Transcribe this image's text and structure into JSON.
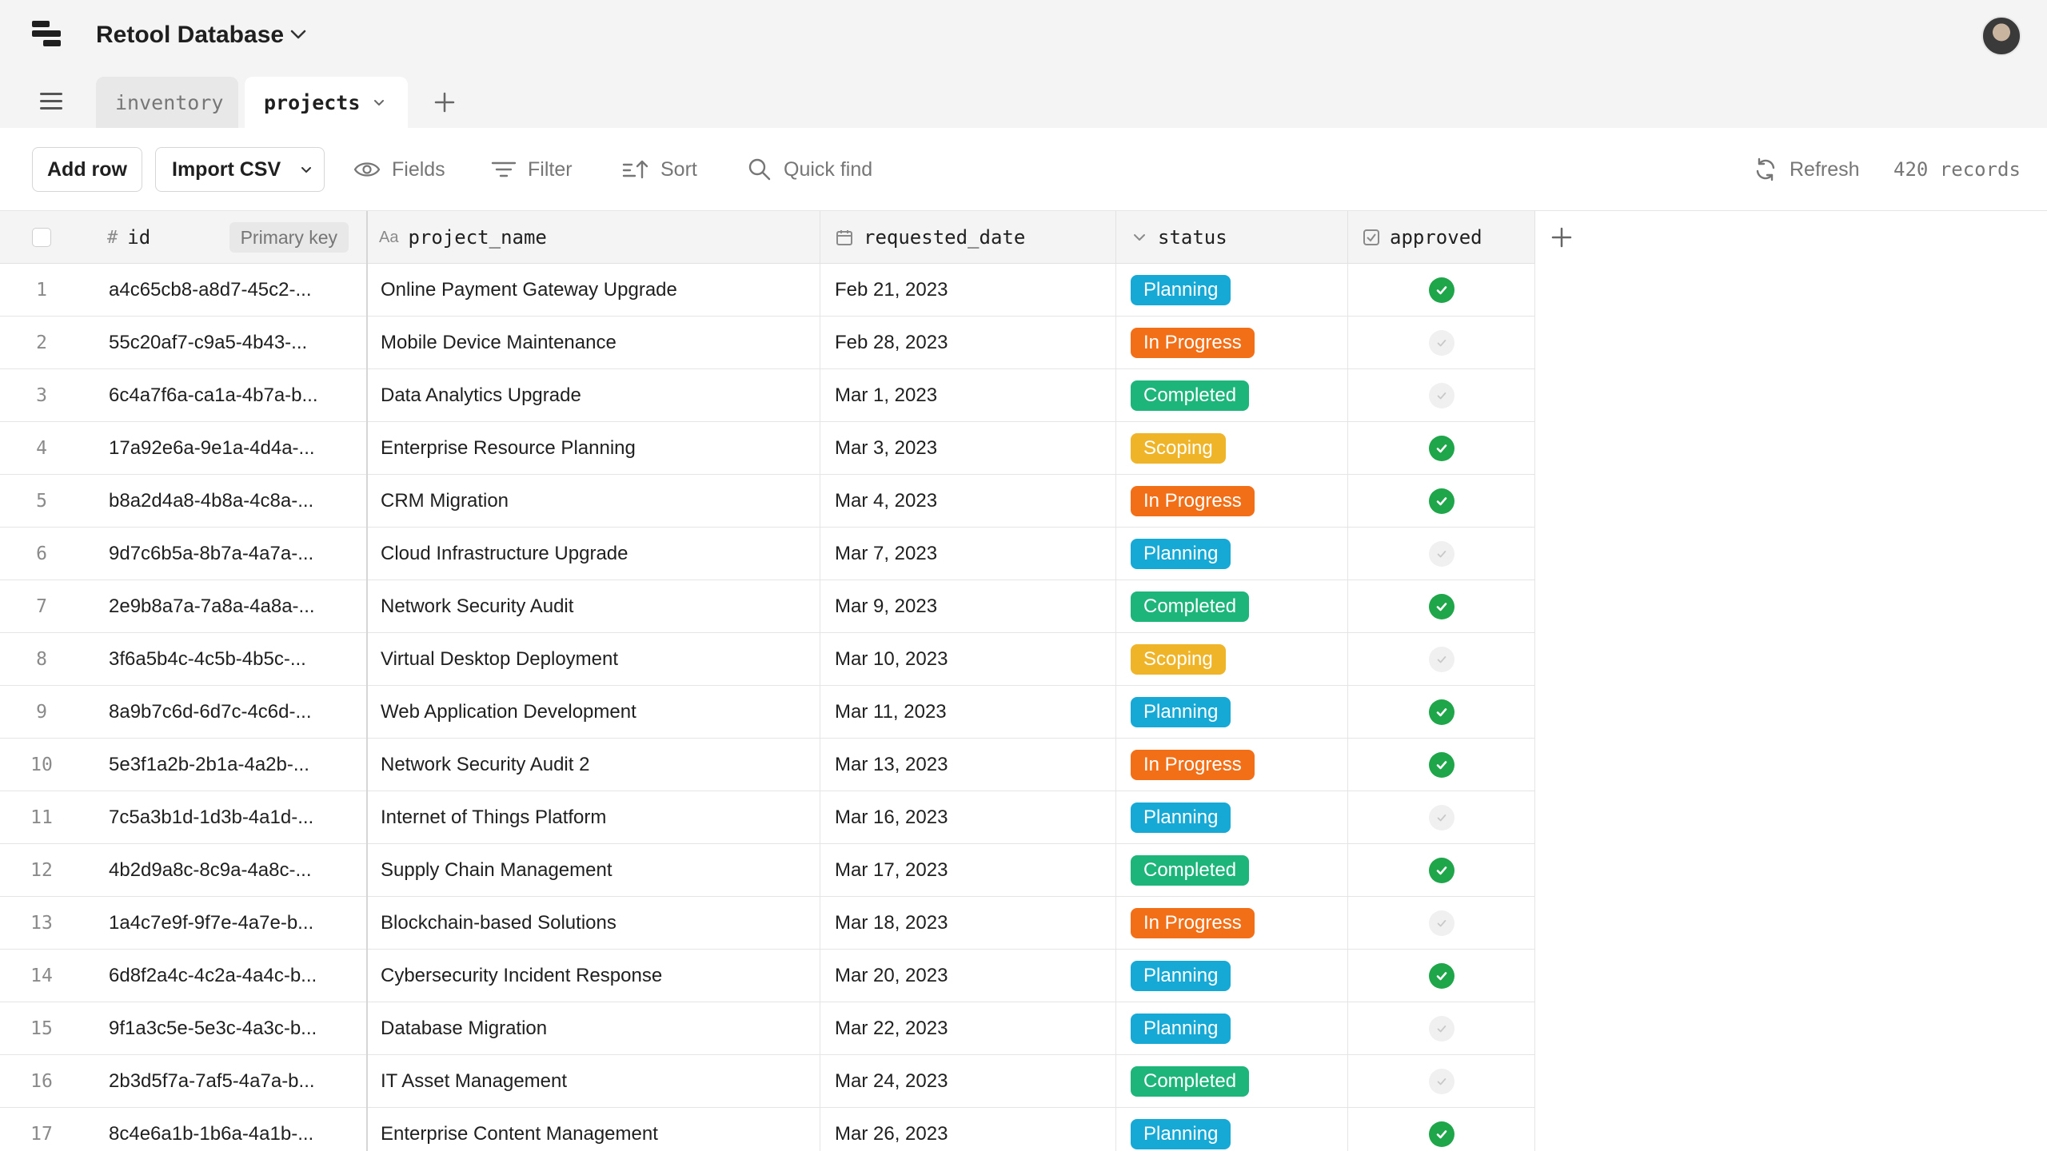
{
  "app": {
    "title": "Retool Database"
  },
  "tabs": [
    {
      "label": "inventory"
    },
    {
      "label": "projects"
    }
  ],
  "toolbar": {
    "add_row": "Add row",
    "import_csv": "Import CSV",
    "fields": "Fields",
    "filter": "Filter",
    "sort": "Sort",
    "quick_find": "Quick find",
    "refresh": "Refresh",
    "records": "420 records"
  },
  "columns": {
    "id": "id",
    "id_tag": "Primary key",
    "project_name": "project_name",
    "requested_date": "requested_date",
    "status": "status",
    "approved": "approved"
  },
  "colors": {
    "Planning": "#17a9d6",
    "In Progress": "#f36f17",
    "Completed": "#1db57a",
    "Scoping": "#f0b429",
    "approved_on": "#1fa54a"
  },
  "rows": [
    {
      "n": "1",
      "id": "a4c65cb8-a8d7-45c2-...",
      "name": "Online Payment Gateway Upgrade",
      "date": "Feb 21, 2023",
      "status": "Planning",
      "approved": true
    },
    {
      "n": "2",
      "id": "55c20af7-c9a5-4b43-...",
      "name": "Mobile Device Maintenance",
      "date": "Feb 28, 2023",
      "status": "In Progress",
      "approved": false
    },
    {
      "n": "3",
      "id": "6c4a7f6a-ca1a-4b7a-b...",
      "name": "Data Analytics Upgrade",
      "date": "Mar 1, 2023",
      "status": "Completed",
      "approved": false
    },
    {
      "n": "4",
      "id": "17a92e6a-9e1a-4d4a-...",
      "name": "Enterprise Resource Planning",
      "date": "Mar 3, 2023",
      "status": "Scoping",
      "approved": true
    },
    {
      "n": "5",
      "id": "b8a2d4a8-4b8a-4c8a-...",
      "name": "CRM Migration",
      "date": "Mar 4, 2023",
      "status": "In Progress",
      "approved": true
    },
    {
      "n": "6",
      "id": "9d7c6b5a-8b7a-4a7a-...",
      "name": "Cloud Infrastructure Upgrade",
      "date": "Mar 7, 2023",
      "status": "Planning",
      "approved": false
    },
    {
      "n": "7",
      "id": "2e9b8a7a-7a8a-4a8a-...",
      "name": "Network Security Audit",
      "date": "Mar 9, 2023",
      "status": "Completed",
      "approved": true
    },
    {
      "n": "8",
      "id": "3f6a5b4c-4c5b-4b5c-...",
      "name": "Virtual Desktop Deployment",
      "date": "Mar 10, 2023",
      "status": "Scoping",
      "approved": false
    },
    {
      "n": "9",
      "id": "8a9b7c6d-6d7c-4c6d-...",
      "name": "Web Application Development",
      "date": "Mar 11, 2023",
      "status": "Planning",
      "approved": true
    },
    {
      "n": "10",
      "id": "5e3f1a2b-2b1a-4a2b-...",
      "name": "Network Security Audit 2",
      "date": "Mar 13, 2023",
      "status": "In Progress",
      "approved": true
    },
    {
      "n": "11",
      "id": "7c5a3b1d-1d3b-4a1d-...",
      "name": "Internet of Things Platform",
      "date": "Mar 16, 2023",
      "status": "Planning",
      "approved": false
    },
    {
      "n": "12",
      "id": "4b2d9a8c-8c9a-4a8c-...",
      "name": "Supply Chain Management",
      "date": "Mar 17, 2023",
      "status": "Completed",
      "approved": true
    },
    {
      "n": "13",
      "id": "1a4c7e9f-9f7e-4a7e-b...",
      "name": "Blockchain-based Solutions",
      "date": "Mar 18, 2023",
      "status": "In Progress",
      "approved": false
    },
    {
      "n": "14",
      "id": "6d8f2a4c-4c2a-4a4c-b...",
      "name": "Cybersecurity Incident Response",
      "date": "Mar 20, 2023",
      "status": "Planning",
      "approved": true
    },
    {
      "n": "15",
      "id": "9f1a3c5e-5e3c-4a3c-b...",
      "name": "Database Migration",
      "date": "Mar 22, 2023",
      "status": "Planning",
      "approved": false
    },
    {
      "n": "16",
      "id": "2b3d5f7a-7af5-4a7a-b...",
      "name": "IT Asset Management",
      "date": "Mar 24, 2023",
      "status": "Completed",
      "approved": false
    },
    {
      "n": "17",
      "id": "8c4e6a1b-1b6a-4a1b-...",
      "name": "Enterprise Content Management",
      "date": "Mar 26, 2023",
      "status": "Planning",
      "approved": true
    }
  ]
}
